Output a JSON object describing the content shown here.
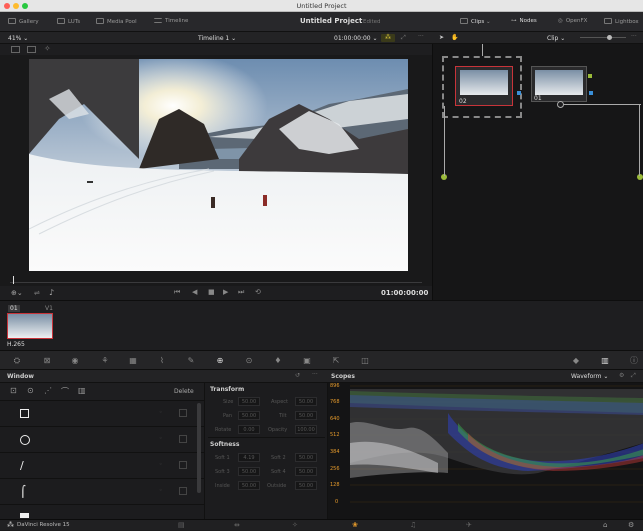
{
  "window": {
    "title": "Untitled Project"
  },
  "topbar": {
    "left": [
      "Gallery",
      "LUTs",
      "Media Pool",
      "Timeline"
    ],
    "project_name": "Untitled Project",
    "project_status": "Edited",
    "right": [
      "Clips",
      "Nodes",
      "OpenFX",
      "Lightbox"
    ]
  },
  "viewer": {
    "zoom": "41%",
    "timeline_name": "Timeline 1",
    "timecode_top": "01:00:00:00",
    "timecode": "01:00:00:00"
  },
  "nodes_header": {
    "mode": "Clip"
  },
  "nodes": [
    {
      "label": "02"
    },
    {
      "label": "01"
    }
  ],
  "clips": {
    "clip_number": "01",
    "track": "V1",
    "codec": "H.265"
  },
  "window_panel": {
    "title": "Window",
    "delete_label": "Delete",
    "transform": {
      "title": "Transform",
      "fields": [
        {
          "label": "Size",
          "value": "50.00"
        },
        {
          "label": "Aspect",
          "value": "50.00"
        },
        {
          "label": "Pan",
          "value": "50.00"
        },
        {
          "label": "Tilt",
          "value": "50.00"
        },
        {
          "label": "Rotate",
          "value": "0.00"
        },
        {
          "label": "Opacity",
          "value": "100.00"
        }
      ]
    },
    "softness": {
      "title": "Softness",
      "fields": [
        {
          "label": "Soft 1",
          "value": "4.19"
        },
        {
          "label": "Soft 2",
          "value": "50.00"
        },
        {
          "label": "Soft 3",
          "value": "50.00"
        },
        {
          "label": "Soft 4",
          "value": "50.00"
        },
        {
          "label": "Inside",
          "value": "50.00"
        },
        {
          "label": "Outside",
          "value": "50.00"
        }
      ]
    }
  },
  "scopes": {
    "title": "Scopes",
    "mode": "Waveform",
    "scale": [
      "896",
      "768",
      "640",
      "512",
      "384",
      "256",
      "128",
      "0"
    ]
  },
  "footer": {
    "app": "DaVinci Resolve 15"
  },
  "colors": {
    "accent_red": "#c8343a",
    "scale_orange": "#e59a2b",
    "node_green": "#9bbb3a",
    "node_blue": "#3a8fd8"
  }
}
